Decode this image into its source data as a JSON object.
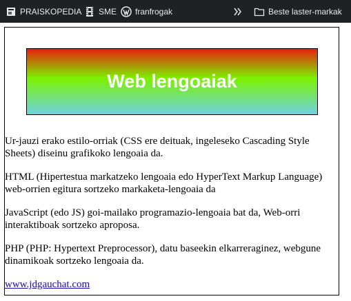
{
  "bookmarks": {
    "items": [
      {
        "label": "PRAISKOPEDIA",
        "icon": "page-icon"
      },
      {
        "label": "SME",
        "icon": "film-strip-icon"
      },
      {
        "label": "franfrogak",
        "icon": "wordpress-icon"
      }
    ],
    "more_icon": "double-chevron-icon",
    "other_label": "Beste laster-markak",
    "other_icon": "folder-icon",
    "colors": {
      "bar": "#202124",
      "text": "#e8eaed"
    }
  },
  "page": {
    "banner_title": "Web lengoaiak",
    "paragraphs": [
      "Ur-jauzi erako estilo-orriak (CSS ere deituak, ingeleseko Cascading Style Sheets) diseinu grafikoko lengoaia da.",
      "HTML (Hipertestua markatzeko lengoaia edo HyperText Markup Language) web-orrien egitura sortzeko markaketa-lengoaia da",
      "JavaScript (edo JS) goi-mailako programazio-lengoaia bat da, Web-orri interaktiboak sortzeko aproposa.",
      "PHP (PHP: Hypertext Preprocessor), datu baseekin elkarreraginez, webgune dinamikoak sortzeko lengoaia da."
    ],
    "link_text": "www.jdgauchat.com",
    "colors": {
      "gradient_top": "#e8200e",
      "gradient_mid": "#7cf200",
      "gradient_bottom": "#6ed2e3",
      "link": "#1a0dab"
    }
  }
}
